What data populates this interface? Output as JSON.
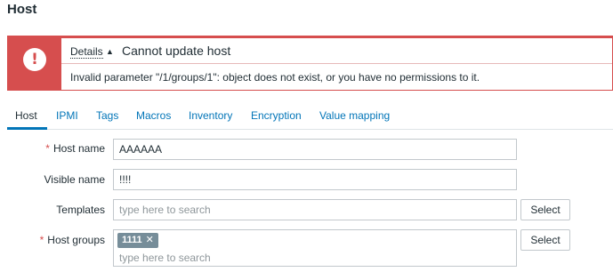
{
  "page": {
    "title": "Host"
  },
  "message": {
    "icon": "exclamation-icon",
    "details_label": "Details",
    "arrow": "▲",
    "title": "Cannot update host",
    "detail": "Invalid parameter \"/1/groups/1\": object does not exist, or you have no permissions to it.",
    "colors": {
      "error": "#d64e4e"
    }
  },
  "tabs": [
    {
      "label": "Host",
      "active": true
    },
    {
      "label": "IPMI"
    },
    {
      "label": "Tags"
    },
    {
      "label": "Macros"
    },
    {
      "label": "Inventory"
    },
    {
      "label": "Encryption"
    },
    {
      "label": "Value mapping"
    }
  ],
  "form": {
    "host_name": {
      "label": "Host name",
      "required_mark": "*",
      "value": "AAAAAA"
    },
    "visible_name": {
      "label": "Visible name",
      "value": "!!!!"
    },
    "templates": {
      "label": "Templates",
      "placeholder": "type here to search",
      "select_label": "Select"
    },
    "host_groups": {
      "label": "Host groups",
      "required_mark": "*",
      "chips": [
        {
          "label": "1111",
          "remove": "✕"
        }
      ],
      "placeholder": "type here to search",
      "select_label": "Select"
    }
  },
  "colors": {
    "link": "#0275b8",
    "text": "#1f2c33",
    "chip": "#768d99"
  }
}
